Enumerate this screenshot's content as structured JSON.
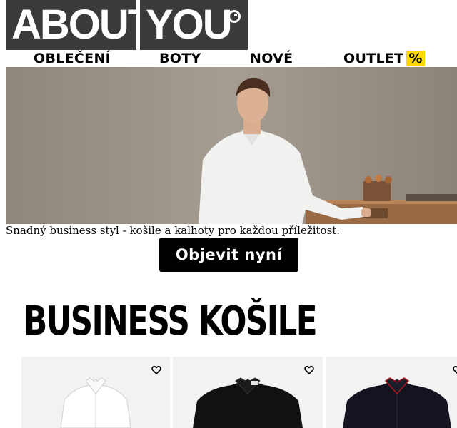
{
  "logo": {
    "part1": "ABOUT",
    "part2": "YOU"
  },
  "nav": {
    "items": [
      {
        "label": "OBLEČENÍ"
      },
      {
        "label": "BOTY"
      },
      {
        "label": "NOVÉ"
      },
      {
        "label": "OUTLET",
        "badge": "%"
      }
    ],
    "badge_color": "#ffd800"
  },
  "hero": {
    "caption": "Snadný business styl - košile a kalhoty pro každou příležitost.",
    "cta_label": "Objevit nyní"
  },
  "section": {
    "title": "BUSINESS KOŠILE"
  },
  "products": [
    {
      "shirt_color": "#ffffff",
      "icon": "heart-icon"
    },
    {
      "shirt_color": "#111111",
      "icon": "heart-icon"
    },
    {
      "shirt_color": "#141420",
      "icon": "heart-icon"
    }
  ]
}
